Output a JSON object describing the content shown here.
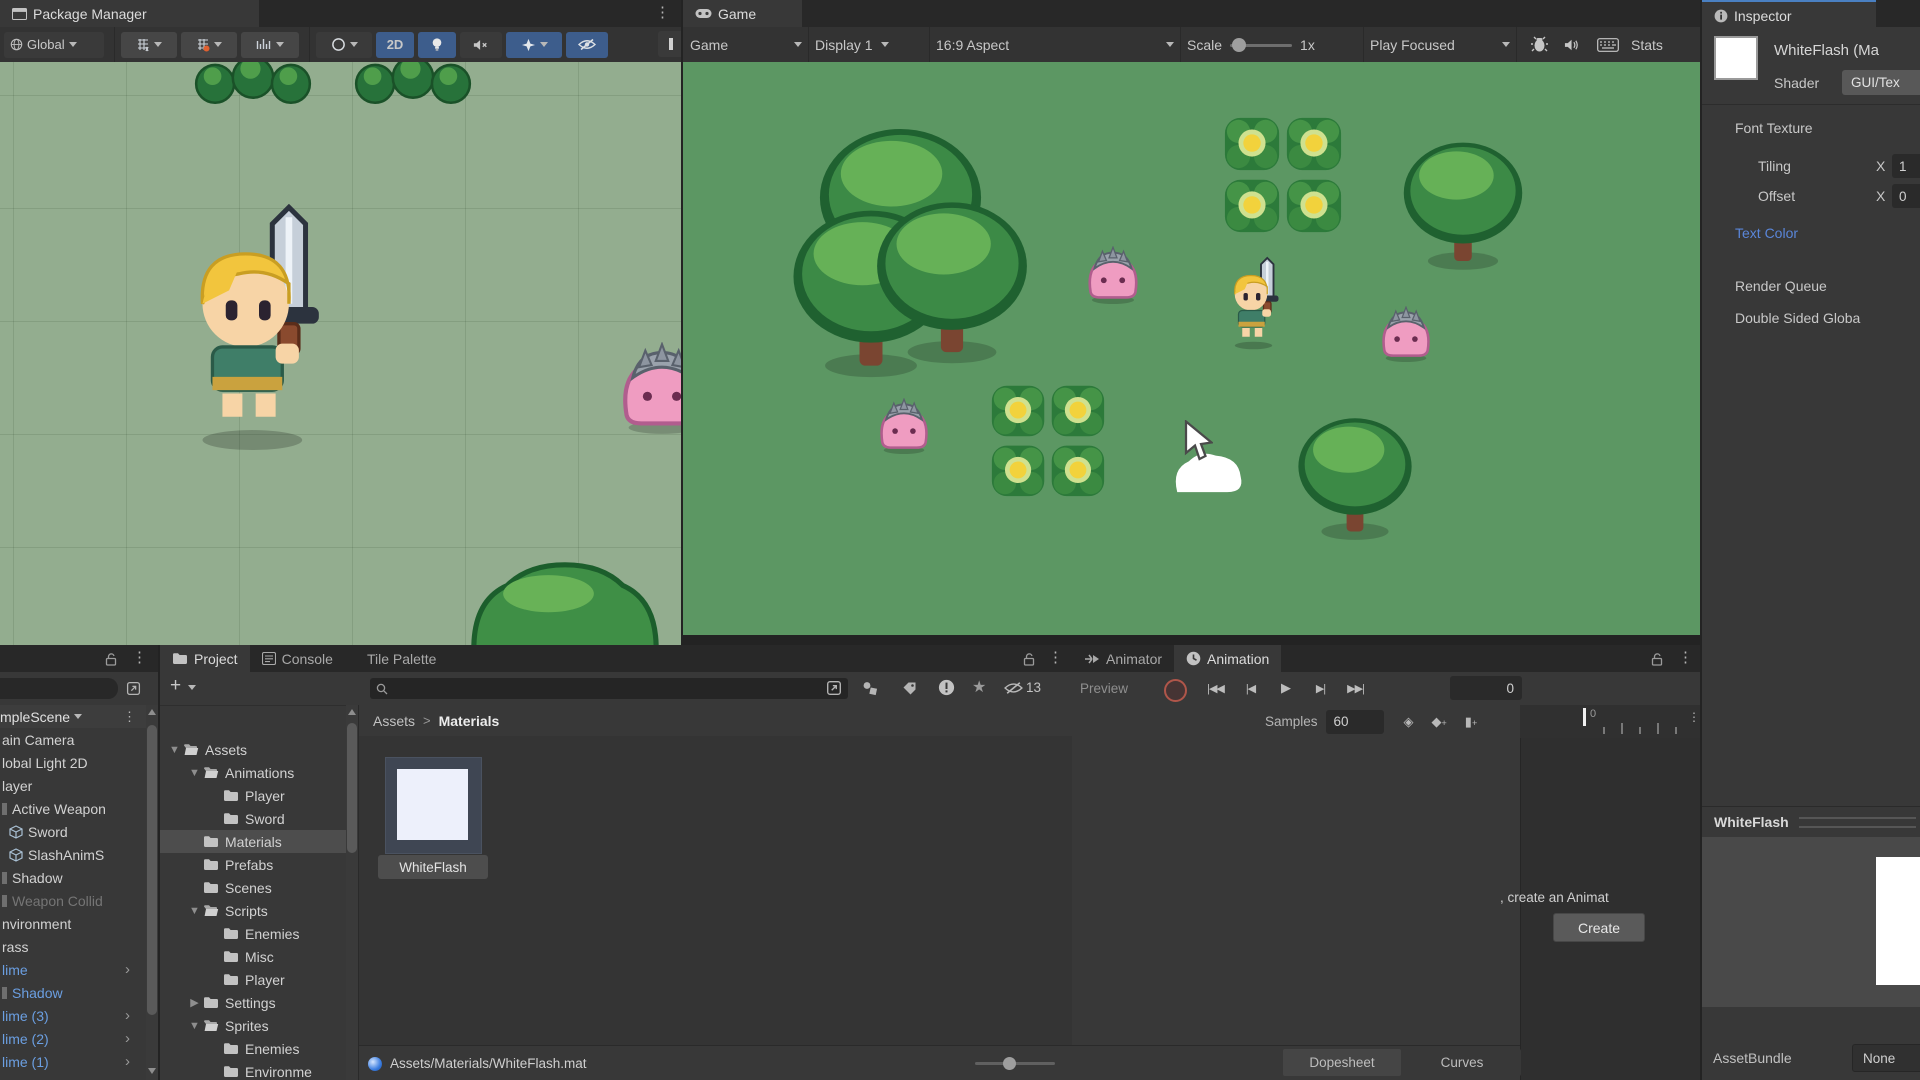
{
  "scene": {
    "tab": "Package Manager",
    "toolbar": {
      "pivot": "Global",
      "mode_2d": "2D"
    }
  },
  "game": {
    "tab": "Game",
    "toolbar": {
      "display_mode": "Game",
      "display": "Display 1",
      "aspect": "16:9 Aspect",
      "scale_label": "Scale",
      "scale_value": "1x",
      "focus_mode": "Play Focused",
      "stats": "Stats"
    }
  },
  "inspector": {
    "tab": "Inspector",
    "title": "WhiteFlash (Ma",
    "shader_label": "Shader",
    "shader_value": "GUI/Tex",
    "section_font_texture": "Font Texture",
    "tiling": {
      "label": "Tiling",
      "axis": "X",
      "value": "1"
    },
    "offset": {
      "label": "Offset",
      "axis": "X",
      "value": "0"
    },
    "text_color": "Text Color",
    "render_queue": "Render Queue",
    "double_sided": "Double Sided Globa",
    "preview_title": "WhiteFlash",
    "asset_bundle": {
      "label": "AssetBundle",
      "value": "None"
    }
  },
  "hierarchy": {
    "scene_header": "mpleScene",
    "items": [
      {
        "label": "ain Camera",
        "style": "normal"
      },
      {
        "label": "lobal Light 2D",
        "style": "normal"
      },
      {
        "label": "layer",
        "style": "normal"
      },
      {
        "label": "Active Weapon",
        "style": "normal",
        "fragment": true
      },
      {
        "label": "Sword",
        "style": "normal",
        "icon": "cube",
        "indent": true
      },
      {
        "label": "SlashAnimS",
        "style": "normal",
        "icon": "cube",
        "indent": true
      },
      {
        "label": "Shadow",
        "style": "normal",
        "fragment": true
      },
      {
        "label": "Weapon Collid",
        "style": "disabled",
        "fragment": true
      },
      {
        "label": "nvironment",
        "style": "normal"
      },
      {
        "label": "rass",
        "style": "normal"
      },
      {
        "label": "lime",
        "style": "prefab",
        "arrow": true
      },
      {
        "label": "Shadow",
        "style": "prefab",
        "fragment": true
      },
      {
        "label": "lime (3)",
        "style": "prefab",
        "arrow": true
      },
      {
        "label": "lime (2)",
        "style": "prefab",
        "arrow": true
      },
      {
        "label": "lime (1)",
        "style": "prefab",
        "arrow": true
      }
    ]
  },
  "project": {
    "tabs": [
      "Project",
      "Console",
      "Tile Palette"
    ],
    "eye_count": "13",
    "tree": [
      {
        "label": "Assets",
        "depth": 0,
        "expander": "open",
        "folder": "open"
      },
      {
        "label": "Animations",
        "depth": 1,
        "expander": "open",
        "folder": "open"
      },
      {
        "label": "Player",
        "depth": 2,
        "expander": "none",
        "folder": "closed"
      },
      {
        "label": "Sword",
        "depth": 2,
        "expander": "none",
        "folder": "closed"
      },
      {
        "label": "Materials",
        "depth": 1,
        "expander": "none",
        "folder": "closed",
        "selected": true
      },
      {
        "label": "Prefabs",
        "depth": 1,
        "expander": "none",
        "folder": "closed"
      },
      {
        "label": "Scenes",
        "depth": 1,
        "expander": "none",
        "folder": "closed"
      },
      {
        "label": "Scripts",
        "depth": 1,
        "expander": "open",
        "folder": "open"
      },
      {
        "label": "Enemies",
        "depth": 2,
        "expander": "none",
        "folder": "closed"
      },
      {
        "label": "Misc",
        "depth": 2,
        "expander": "none",
        "folder": "closed"
      },
      {
        "label": "Player",
        "depth": 2,
        "expander": "none",
        "folder": "closed"
      },
      {
        "label": "Settings",
        "depth": 1,
        "expander": "closed",
        "folder": "closed"
      },
      {
        "label": "Sprites",
        "depth": 1,
        "expander": "open",
        "folder": "open"
      },
      {
        "label": "Enemies",
        "depth": 2,
        "expander": "none",
        "folder": "closed"
      },
      {
        "label": "Environme",
        "depth": 2,
        "expander": "none",
        "folder": "closed"
      }
    ],
    "breadcrumb": {
      "root": "Assets",
      "sep": ">",
      "current": "Materials"
    },
    "asset_label": "WhiteFlash",
    "status_path": "Assets/Materials/WhiteFlash.mat"
  },
  "animation": {
    "tabs": {
      "animator": "Animator",
      "animation": "Animation"
    },
    "preview_label": "Preview",
    "frame_value": "0",
    "samples_label": "Samples",
    "samples_value": "60",
    "ruler_zero": "0",
    "hint": ", create an Animat",
    "create_button": "Create",
    "dopesheet": "Dopesheet",
    "curves": "Curves"
  },
  "colors": {
    "panel_bg": "#383838",
    "tabbar_bg": "#282828",
    "tool_active_blue": "#3d5d8c",
    "prefab_blue": "#6b9fe2",
    "link_blue": "#5a86d9",
    "selection_gray": "#4d4d4d",
    "scene_green": "#93ad8f",
    "game_green": "#5c9763",
    "record_red": "#b0564a"
  }
}
